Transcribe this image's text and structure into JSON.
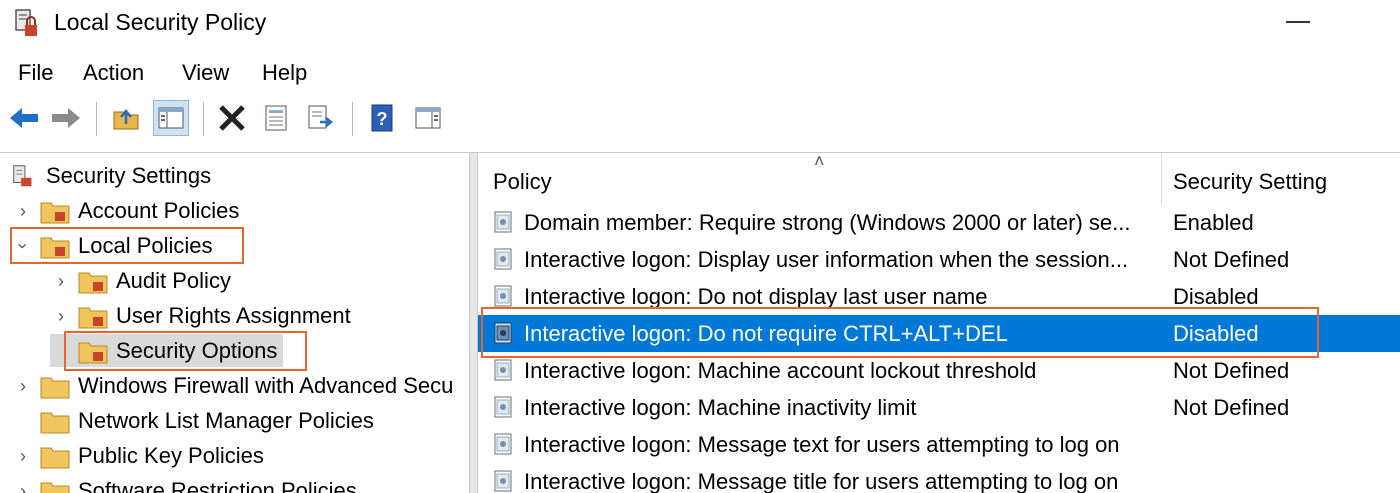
{
  "window": {
    "title": "Local Security Policy"
  },
  "menu": [
    "File",
    "Action",
    "View",
    "Help"
  ],
  "toolbar": {
    "icons": [
      "back-arrow-icon",
      "forward-arrow-icon",
      "up-folder-icon",
      "show-hide-tree-icon",
      "delete-icon",
      "properties-icon",
      "export-list-icon",
      "help-icon",
      "action-pane-icon"
    ]
  },
  "tree": {
    "root": "Security Settings",
    "items": [
      {
        "label": "Account Policies",
        "level": 1,
        "chevron": "collapsed"
      },
      {
        "label": "Local Policies",
        "level": 1,
        "chevron": "expanded"
      },
      {
        "label": "Audit Policy",
        "level": 2,
        "chevron": "collapsed"
      },
      {
        "label": "User Rights Assignment",
        "level": 2,
        "chevron": "collapsed"
      },
      {
        "label": "Security Options",
        "level": 2,
        "chevron": "none"
      },
      {
        "label": "Windows Firewall with Advanced Secu",
        "level": 1,
        "chevron": "collapsed"
      },
      {
        "label": "Network List Manager Policies",
        "level": 1,
        "chevron": "none"
      },
      {
        "label": "Public Key Policies",
        "level": 1,
        "chevron": "collapsed"
      },
      {
        "label": "Software Restriction Policies",
        "level": 1,
        "chevron": "collapsed"
      }
    ]
  },
  "list": {
    "headers": {
      "policy": "Policy",
      "setting": "Security Setting"
    },
    "rows": [
      {
        "policy": "Domain member: Require strong (Windows 2000 or later) se...",
        "setting": "Enabled"
      },
      {
        "policy": "Interactive logon: Display user information when the session...",
        "setting": "Not Defined"
      },
      {
        "policy": "Interactive logon: Do not display last user name",
        "setting": "Disabled"
      },
      {
        "policy": "Interactive logon: Do not require CTRL+ALT+DEL",
        "setting": "Disabled"
      },
      {
        "policy": "Interactive logon: Machine account lockout threshold",
        "setting": "Not Defined"
      },
      {
        "policy": "Interactive logon: Machine inactivity limit",
        "setting": "Not Defined"
      },
      {
        "policy": "Interactive logon: Message text for users attempting to log on",
        "setting": ""
      },
      {
        "policy": "Interactive logon: Message title for users attempting to log on",
        "setting": ""
      }
    ]
  },
  "colors": {
    "selection": "#0078d7",
    "highlight_outline": "#e3662f"
  }
}
